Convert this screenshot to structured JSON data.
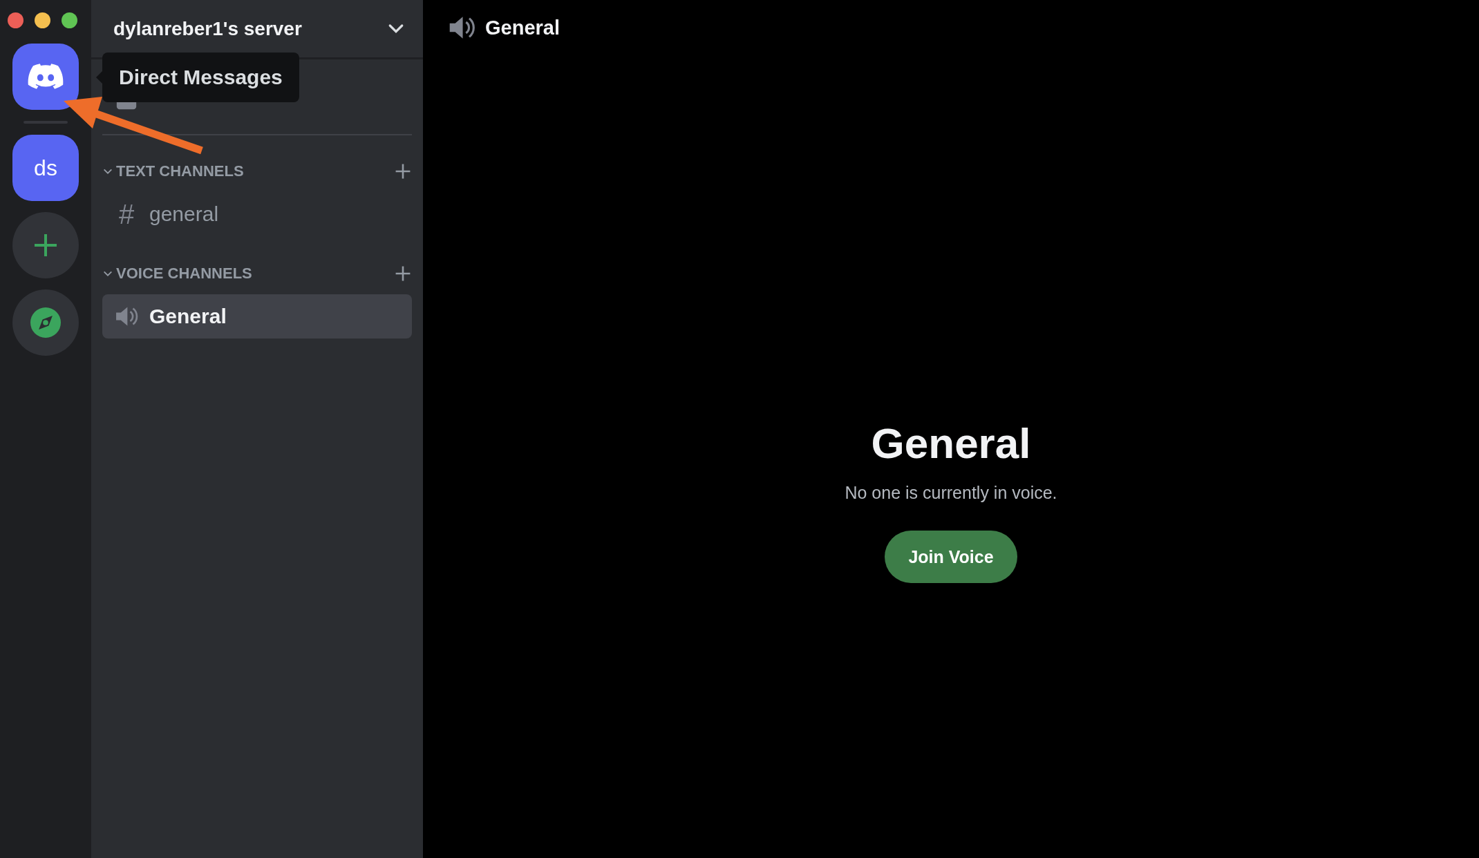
{
  "server_rail": [
    {
      "kind": "home",
      "selected": true
    },
    {
      "kind": "server",
      "label": "ds"
    },
    {
      "kind": "add"
    },
    {
      "kind": "explore"
    }
  ],
  "tooltip": {
    "text": "Direct Messages"
  },
  "sidebar": {
    "server_name": "dylanreber1's server",
    "items": [
      {
        "kind": "events"
      }
    ],
    "categories": [
      {
        "title": "TEXT CHANNELS",
        "expanded": true,
        "channels": [
          {
            "kind": "text",
            "icon": "#",
            "name": "general",
            "selected": false
          }
        ]
      },
      {
        "title": "VOICE CHANNELS",
        "expanded": true,
        "channels": [
          {
            "kind": "voice",
            "name": "General",
            "selected": true
          }
        ]
      }
    ]
  },
  "header": {
    "channel_name": "General"
  },
  "voice_panel": {
    "title": "General",
    "subtitle": "No one is currently in voice.",
    "button": "Join Voice"
  }
}
